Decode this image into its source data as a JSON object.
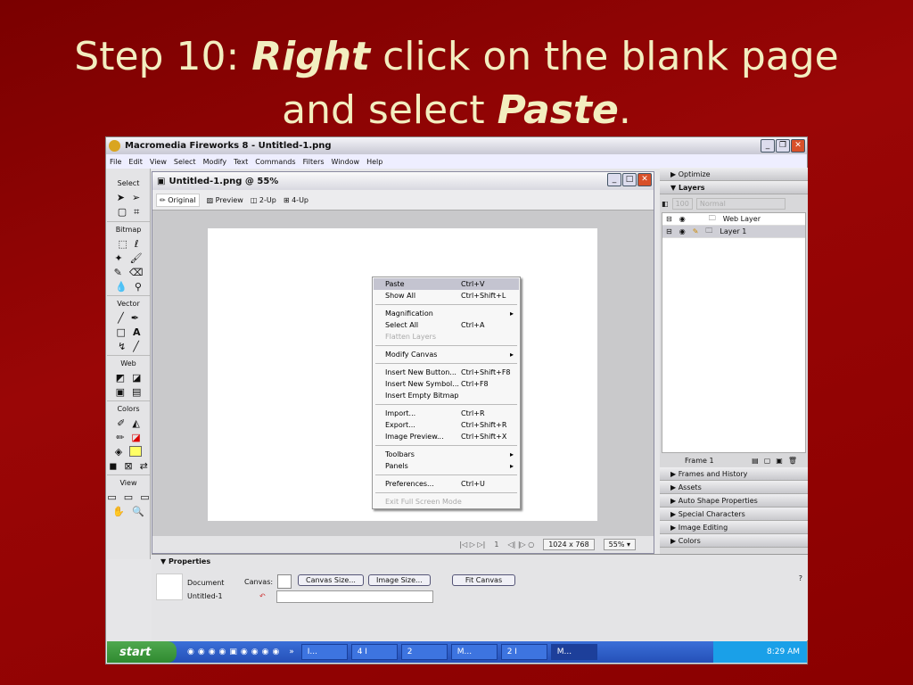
{
  "slide": {
    "title_prefix": "Step 10: ",
    "title_em1": "Right",
    "title_mid": " click on the blank page",
    "title_line2_pre": "and select ",
    "title_em2": "Paste",
    "title_end": "."
  },
  "app": {
    "title": "Macromedia Fireworks 8 - Untitled-1.png",
    "menu": [
      "File",
      "Edit",
      "View",
      "Select",
      "Modify",
      "Text",
      "Commands",
      "Filters",
      "Window",
      "Help"
    ]
  },
  "tools": {
    "sections": [
      "Select",
      "Bitmap",
      "Vector",
      "Web",
      "Colors",
      "View"
    ]
  },
  "document": {
    "title": "Untitled-1.png @ 55%",
    "tabs": [
      "Original",
      "Preview",
      "2-Up",
      "4-Up"
    ],
    "frame": "1",
    "size": "1024 x 768",
    "zoom": "55%"
  },
  "context_menu": {
    "items": [
      {
        "label": "Paste",
        "shortcut": "Ctrl+V"
      },
      {
        "label": "Show All",
        "shortcut": "Ctrl+Shift+L"
      },
      {
        "label": "Magnification",
        "shortcut": ""
      },
      {
        "label": "Select All",
        "shortcut": "Ctrl+A"
      },
      {
        "label": "Flatten Layers",
        "shortcut": ""
      },
      {
        "label": "Modify Canvas",
        "shortcut": ""
      },
      {
        "label": "Insert New Button...",
        "shortcut": "Ctrl+Shift+F8"
      },
      {
        "label": "Insert New Symbol...",
        "shortcut": "Ctrl+F8"
      },
      {
        "label": "Insert Empty Bitmap",
        "shortcut": ""
      },
      {
        "label": "Import...",
        "shortcut": "Ctrl+R"
      },
      {
        "label": "Export...",
        "shortcut": "Ctrl+Shift+R"
      },
      {
        "label": "Image Preview...",
        "shortcut": "Ctrl+Shift+X"
      },
      {
        "label": "Toolbars",
        "shortcut": ""
      },
      {
        "label": "Panels",
        "shortcut": ""
      },
      {
        "label": "Preferences...",
        "shortcut": "Ctrl+U"
      },
      {
        "label": "Exit Full Screen Mode",
        "shortcut": ""
      }
    ]
  },
  "panels": {
    "optimize": "Optimize",
    "layers": "Layers",
    "opacity": "100",
    "blend": "Normal",
    "layer_list": [
      "Web Layer",
      "Layer 1"
    ],
    "frame": "Frame 1",
    "collapsed": [
      "Frames and History",
      "Assets",
      "Auto Shape Properties",
      "Special Characters",
      "Image Editing",
      "Colors"
    ]
  },
  "properties": {
    "title": "Properties",
    "doc_type": "Document",
    "doc_name": "Untitled-1",
    "canvas_label": "Canvas:",
    "canvas_size": "Canvas Size...",
    "image_size": "Image Size...",
    "fit_canvas": "Fit Canvas"
  },
  "taskbar": {
    "start": "start",
    "tasks": [
      "I...",
      "4 I",
      "2",
      "M...",
      "2 I",
      "M..."
    ],
    "clock": "8:29 AM"
  }
}
